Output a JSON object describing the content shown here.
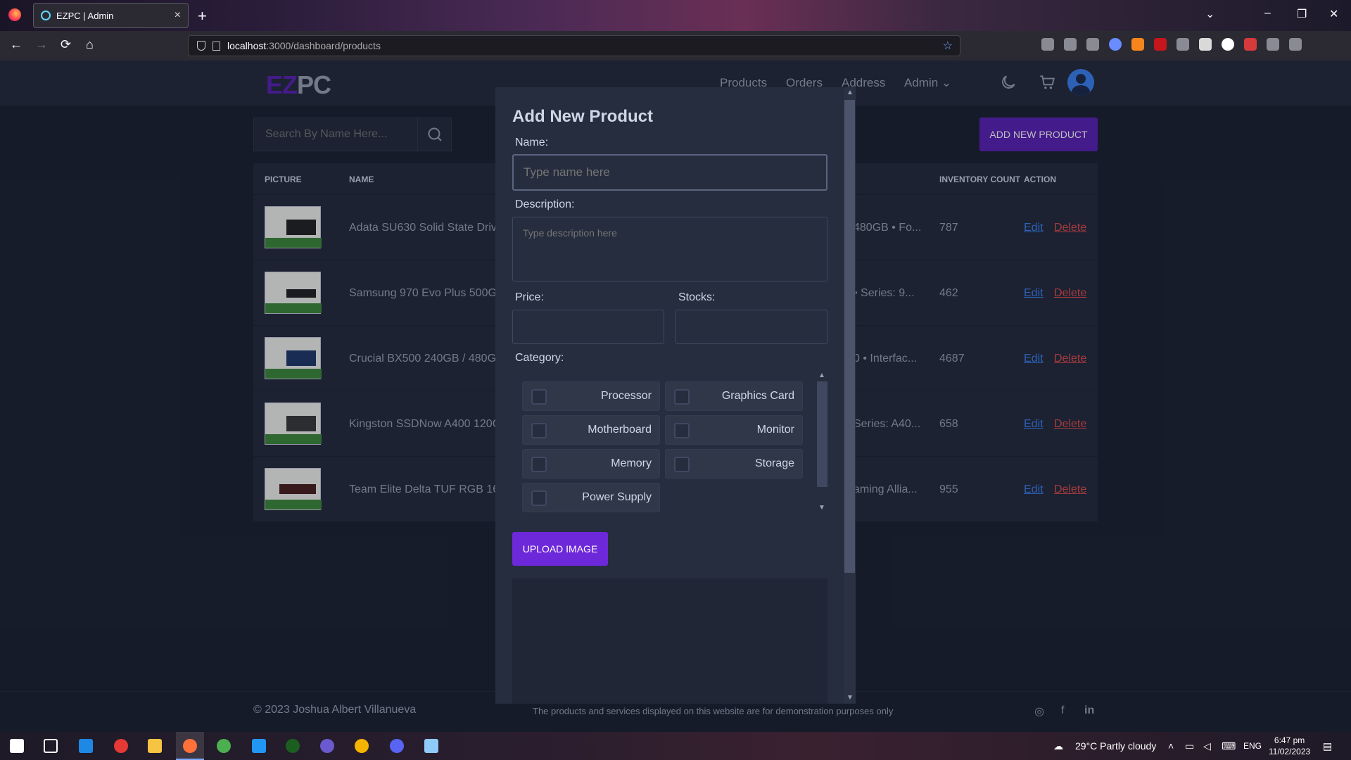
{
  "browser": {
    "tab_title": "EZPC | Admin",
    "new_tab": "+",
    "url_host": "localhost",
    "url_rest": ":3000/dashboard/products",
    "window_controls": {
      "minimize": "–",
      "restore": "❐",
      "close": "✕"
    },
    "nav_icons": {
      "back": "←",
      "forward": "→",
      "reload": "⟳",
      "home": "⌂"
    }
  },
  "app": {
    "logo_a": "EZ",
    "logo_b": "PC",
    "nav": [
      "Products",
      "Orders",
      "Address",
      "Admin"
    ],
    "admin_chevron": "⌄",
    "search_placeholder": "Search By Name Here...",
    "add_button": "ADD NEW PRODUCT",
    "table_headers": {
      "picture": "PICTURE",
      "name": "NAME",
      "inventory": "INVENTORY COUNT",
      "action": "ACTION"
    },
    "rows": [
      {
        "name": "Adata SU630 Solid State Drive",
        "desc": "480GB • Fo...",
        "inventory": "787",
        "edit": "Edit",
        "delete": "Delete"
      },
      {
        "name": "Samsung 970 Evo Plus 500GB",
        "desc": "• Series: 9...",
        "inventory": "462",
        "edit": "Edit",
        "delete": "Delete"
      },
      {
        "name": "Crucial BX500 240GB / 480GB",
        "desc": "0 • Interfac...",
        "inventory": "4687",
        "edit": "Edit",
        "delete": "Delete"
      },
      {
        "name": "Kingston SSDNow A400 120G",
        "desc": "Series: A40...",
        "inventory": "658",
        "edit": "Edit",
        "delete": "Delete"
      },
      {
        "name": "Team Elite Delta TUF RGB 16G",
        "desc": "aming Allia...",
        "inventory": "955",
        "edit": "Edit",
        "delete": "Delete"
      }
    ],
    "footer": {
      "copyright": "© 2023 Joshua Albert Villanueva",
      "disclaimer": "The products and services displayed on this website are for demonstration purposes only"
    }
  },
  "modal": {
    "title": "Add New Product",
    "name_label": "Name:",
    "name_placeholder": "Type name here",
    "description_label": "Description:",
    "description_placeholder": "Type description here",
    "price_label": "Price:",
    "stocks_label": "Stocks:",
    "category_label": "Category:",
    "categories": [
      "Processor",
      "Graphics Card",
      "Motherboard",
      "Monitor",
      "Memory",
      "Storage",
      "Power Supply"
    ],
    "upload_button": "UPLOAD IMAGE"
  },
  "taskbar": {
    "weather": "29°C  Partly cloudy",
    "lang": "ENG",
    "time": "6:47 pm",
    "date": "11/02/2023"
  },
  "colors": {
    "accent": "#5b21b6",
    "page_bg": "#1b2131",
    "panel_bg": "#232a3b",
    "link": "#3b82f6",
    "danger": "#e24d4d"
  }
}
